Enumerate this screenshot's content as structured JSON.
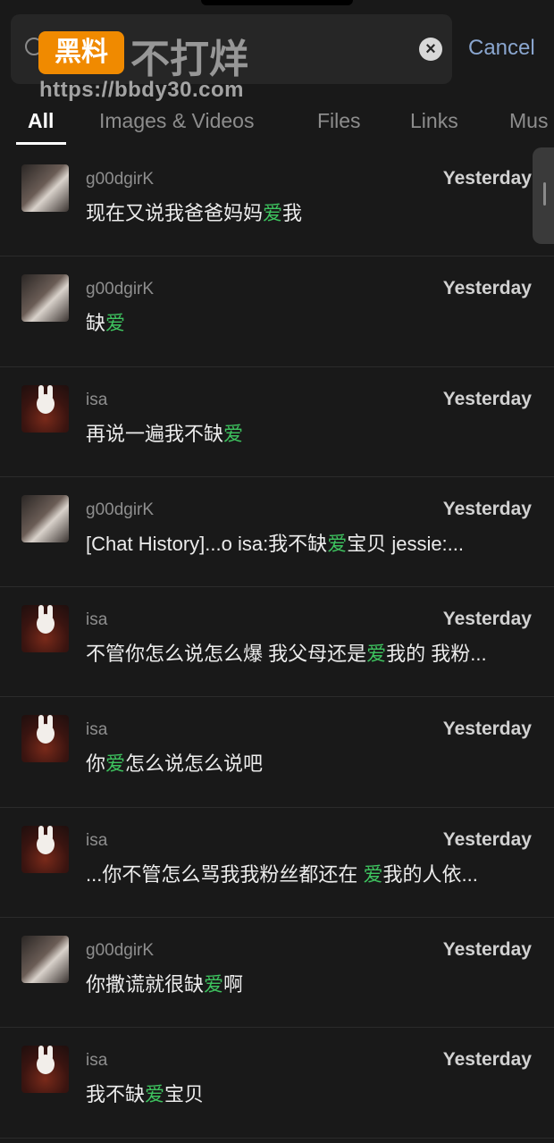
{
  "search": {
    "query": "爱",
    "cancel_label": "Cancel"
  },
  "watermark": {
    "logo_text": "黑料",
    "title": "不打烊",
    "url": "https://bbdy30.com"
  },
  "tabs": [
    {
      "label": "All",
      "active": true
    },
    {
      "label": "Images & Videos",
      "active": false
    },
    {
      "label": "Files",
      "active": false
    },
    {
      "label": "Links",
      "active": false
    },
    {
      "label": "Mus",
      "active": false
    }
  ],
  "results": [
    {
      "sender": "g00dgirK",
      "avatar": "girl",
      "time": "Yesterday",
      "pre": "现在又说我爸爸妈妈",
      "hl": "爱",
      "post": "我"
    },
    {
      "sender": "g00dgirK",
      "avatar": "girl",
      "time": "Yesterday",
      "pre": "缺",
      "hl": "爱",
      "post": ""
    },
    {
      "sender": "isa",
      "avatar": "bunny",
      "time": "Yesterday",
      "pre": "再说一遍我不缺",
      "hl": "爱",
      "post": ""
    },
    {
      "sender": "g00dgirK",
      "avatar": "girl",
      "time": "Yesterday",
      "pre": "[Chat History]...o isa:我不缺",
      "hl": "爱",
      "post": "宝贝 jessie:..."
    },
    {
      "sender": "isa",
      "avatar": "bunny",
      "time": "Yesterday",
      "pre": "不管你怎么说怎么爆 我父母还是",
      "hl": "爱",
      "post": "我的 我粉..."
    },
    {
      "sender": "isa",
      "avatar": "bunny",
      "time": "Yesterday",
      "pre": "你",
      "hl": "爱",
      "post": "怎么说怎么说吧"
    },
    {
      "sender": "isa",
      "avatar": "bunny",
      "time": "Yesterday",
      "pre": "...你不管怎么骂我我粉丝都还在 ",
      "hl": "爱",
      "post": "我的人依..."
    },
    {
      "sender": "g00dgirK",
      "avatar": "girl",
      "time": "Yesterday",
      "pre": "你撒谎就很缺",
      "hl": "爱",
      "post": "啊"
    },
    {
      "sender": "isa",
      "avatar": "bunny",
      "time": "Yesterday",
      "pre": "我不缺",
      "hl": "爱",
      "post": "宝贝"
    }
  ]
}
